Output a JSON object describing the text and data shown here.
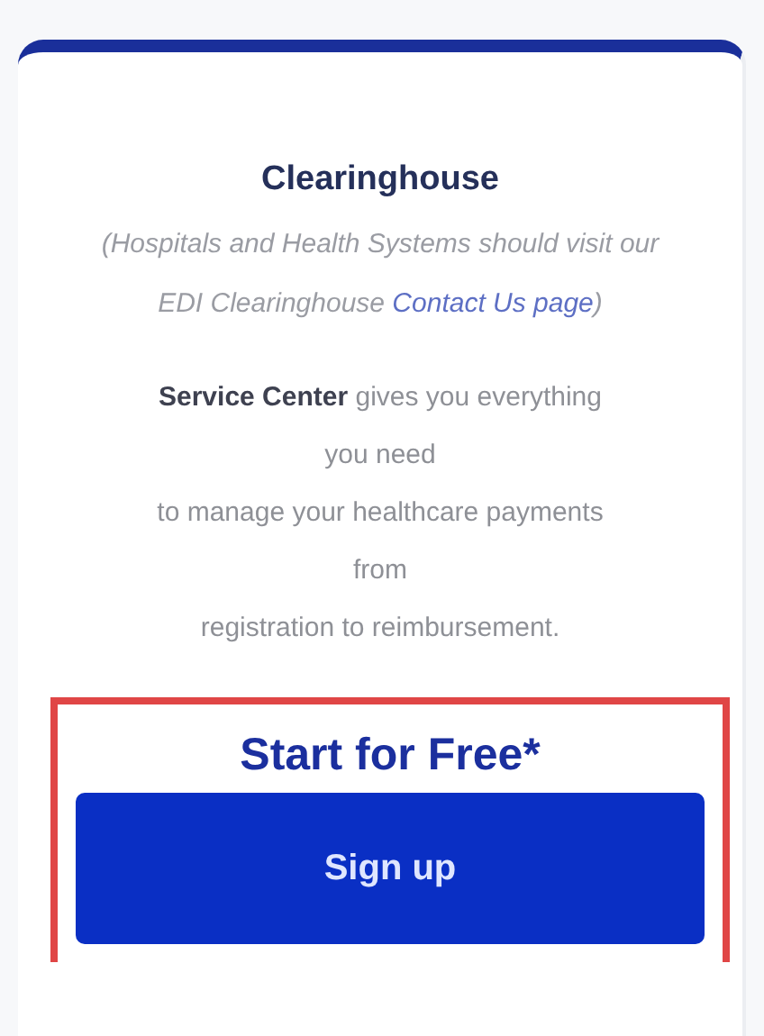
{
  "card": {
    "title": "Clearinghouse",
    "note": {
      "text": "(Hospitals and Health Systems should visit our EDI Clearinghouse",
      "link": "Contact Us page",
      "after": ")"
    },
    "description_lines": [
      "**Service Center** gives you everything",
      "you need",
      "to manage your healthcare payments",
      "from",
      "registration to reimbursement."
    ],
    "cta": {
      "highlighted": true,
      "heading": "Start for Free*",
      "button": "Sign up"
    }
  }
}
